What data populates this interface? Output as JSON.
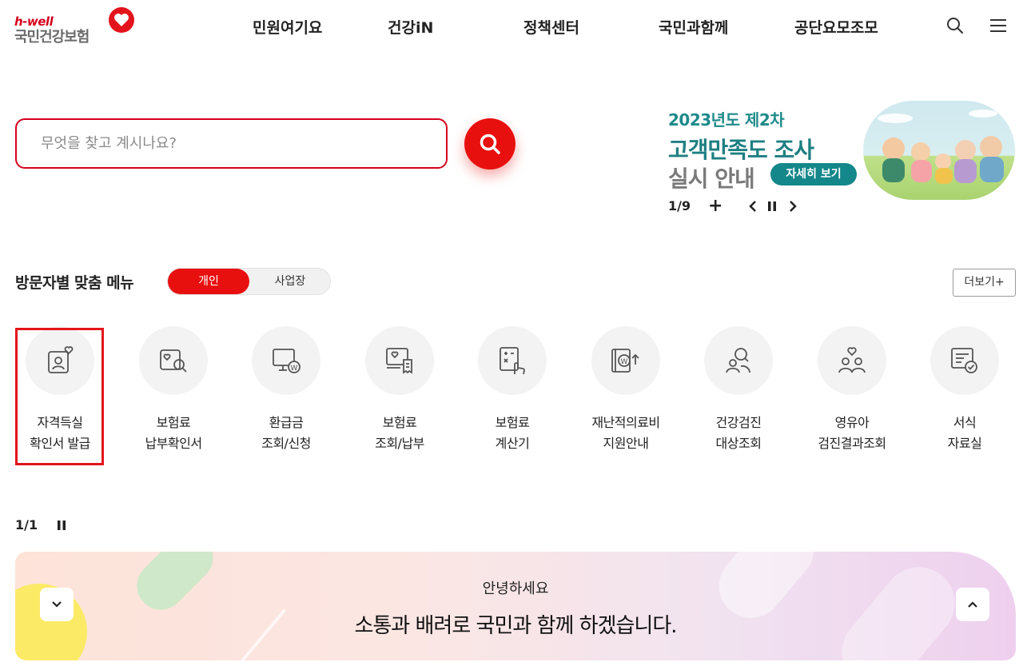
{
  "header": {
    "logo_tagline": "h-well",
    "logo_name": "국민건강보험",
    "nav": [
      "민원여기요",
      "건강iN",
      "정책센터",
      "국민과함께",
      "공단요모조모"
    ]
  },
  "search": {
    "placeholder": "무엇을 찾고 계시나요?"
  },
  "banner": {
    "line1": "2023년도 제2차",
    "line2": "고객만족도 조사",
    "line3": "실시 안내",
    "cta": "자세히 보기",
    "counter": "1/9",
    "plus": "+"
  },
  "visitor": {
    "title": "방문자별 맞춤 메뉴",
    "tab_personal": "개인",
    "tab_business": "사업장",
    "more": "더보기+",
    "services": [
      {
        "line1": "자격득실",
        "line2": "확인서 발급"
      },
      {
        "line1": "보험료",
        "line2": "납부확인서"
      },
      {
        "line1": "환급금",
        "line2": "조회/신청"
      },
      {
        "line1": "보험료",
        "line2": "조회/납부"
      },
      {
        "line1": "보험료",
        "line2": "계산기"
      },
      {
        "line1": "재난적의료비",
        "line2": "지원안내"
      },
      {
        "line1": "건강검진",
        "line2": "대상조회"
      },
      {
        "line1": "영유아",
        "line2": "검진결과조회"
      },
      {
        "line1": "서식",
        "line2": "자료실"
      }
    ],
    "pager": "1/1"
  },
  "notice": {
    "small": "안녕하세요",
    "big": "소통과 배려로 국민과 함께 하겠습니다."
  },
  "colors": {
    "brand_red": "#e8100f",
    "teal": "#1e7f82",
    "highlight": "#e3141b"
  }
}
